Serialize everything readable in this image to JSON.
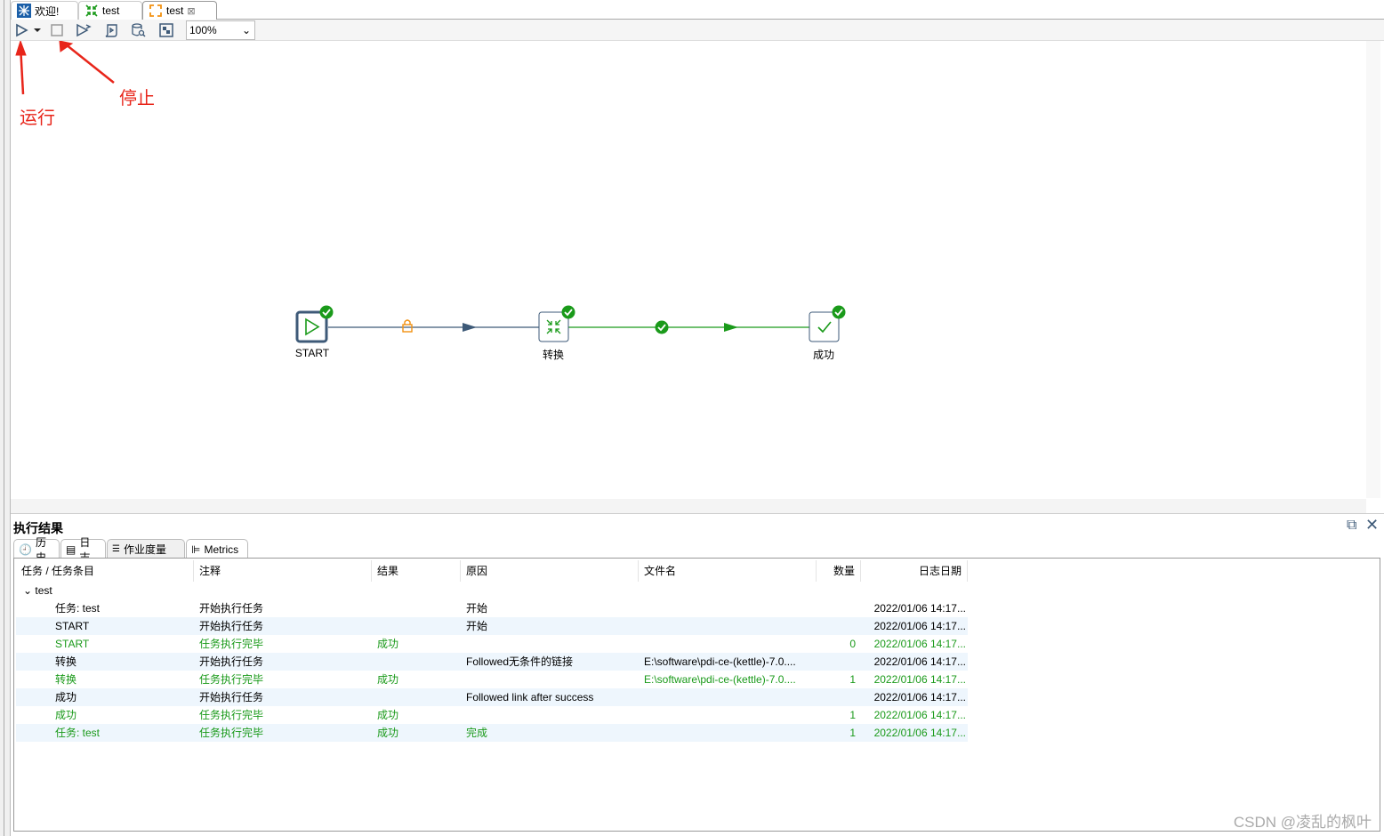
{
  "tabs": [
    {
      "label": "欢迎!",
      "icon": "spoon-icon"
    },
    {
      "label": "test",
      "icon": "transformation-icon"
    },
    {
      "label": "test",
      "icon": "job-icon",
      "active": true
    }
  ],
  "toolbar": {
    "zoom": "100%"
  },
  "annotations": {
    "run": "运行",
    "stop": "停止"
  },
  "canvas": {
    "nodes": [
      {
        "label": "START",
        "status": "success"
      },
      {
        "label": "转换",
        "status": "success"
      },
      {
        "label": "成功",
        "status": "success"
      }
    ]
  },
  "results": {
    "title": "执行结果",
    "tabs": [
      {
        "label": "历史"
      },
      {
        "label": "日志"
      },
      {
        "label": "作业度量",
        "active": true
      },
      {
        "label": "Metrics"
      }
    ],
    "columns": [
      "任务 / 任务条目",
      "注释",
      "结果",
      "原因",
      "文件名",
      "数量",
      "日志日期"
    ],
    "group": "test",
    "rows": [
      {
        "cells": [
          "任务: test",
          "开始执行任务",
          "",
          "开始",
          "",
          "",
          "2022/01/06 14:17..."
        ],
        "ok": false
      },
      {
        "cells": [
          "START",
          "开始执行任务",
          "",
          "开始",
          "",
          "",
          "2022/01/06 14:17..."
        ],
        "ok": false
      },
      {
        "cells": [
          "START",
          "任务执行完毕",
          "成功",
          "",
          "",
          "0",
          "2022/01/06 14:17..."
        ],
        "ok": true
      },
      {
        "cells": [
          "转换",
          "开始执行任务",
          "",
          "Followed无条件的链接",
          "E:\\software\\pdi-ce-(kettle)-7.0....",
          "",
          "2022/01/06 14:17..."
        ],
        "ok": false
      },
      {
        "cells": [
          "转换",
          "任务执行完毕",
          "成功",
          "",
          "E:\\software\\pdi-ce-(kettle)-7.0....",
          "1",
          "2022/01/06 14:17..."
        ],
        "ok": true
      },
      {
        "cells": [
          "成功",
          "开始执行任务",
          "",
          "Followed link after success",
          "",
          "",
          "2022/01/06 14:17..."
        ],
        "ok": false
      },
      {
        "cells": [
          "成功",
          "任务执行完毕",
          "成功",
          "",
          "",
          "1",
          "2022/01/06 14:17..."
        ],
        "ok": true
      },
      {
        "cells": [
          "任务: test",
          "任务执行完毕",
          "成功",
          "完成",
          "",
          "1",
          "2022/01/06 14:17..."
        ],
        "ok": true
      }
    ]
  },
  "watermark": "CSDN @凌乱的枫叶",
  "colors": {
    "success": "#1a9a1a",
    "hop": "#3e5a78",
    "annotation": "#e8251a",
    "alt_row": "#eef6fd"
  }
}
